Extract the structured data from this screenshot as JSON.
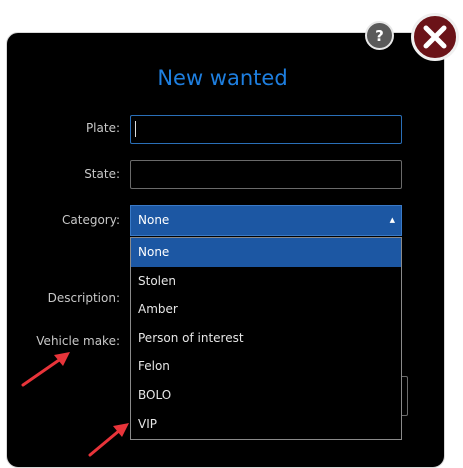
{
  "dialog": {
    "title": "New wanted",
    "help_label": "?",
    "fields": {
      "plate_label": "Plate:",
      "state_label": "State:",
      "category_label": "Category:",
      "description_label": "Description:",
      "vehicle_make_label": "Vehicle make:"
    },
    "category": {
      "selected": "None",
      "options": [
        "None",
        "Stolen",
        "Amber",
        "Person of interest",
        "Felon",
        "BOLO",
        "VIP"
      ]
    }
  },
  "colors": {
    "title": "#1e7fe0",
    "selection": "#1c57a3",
    "close_button": "#6b1318",
    "annotation_arrow": "#e8343a"
  }
}
